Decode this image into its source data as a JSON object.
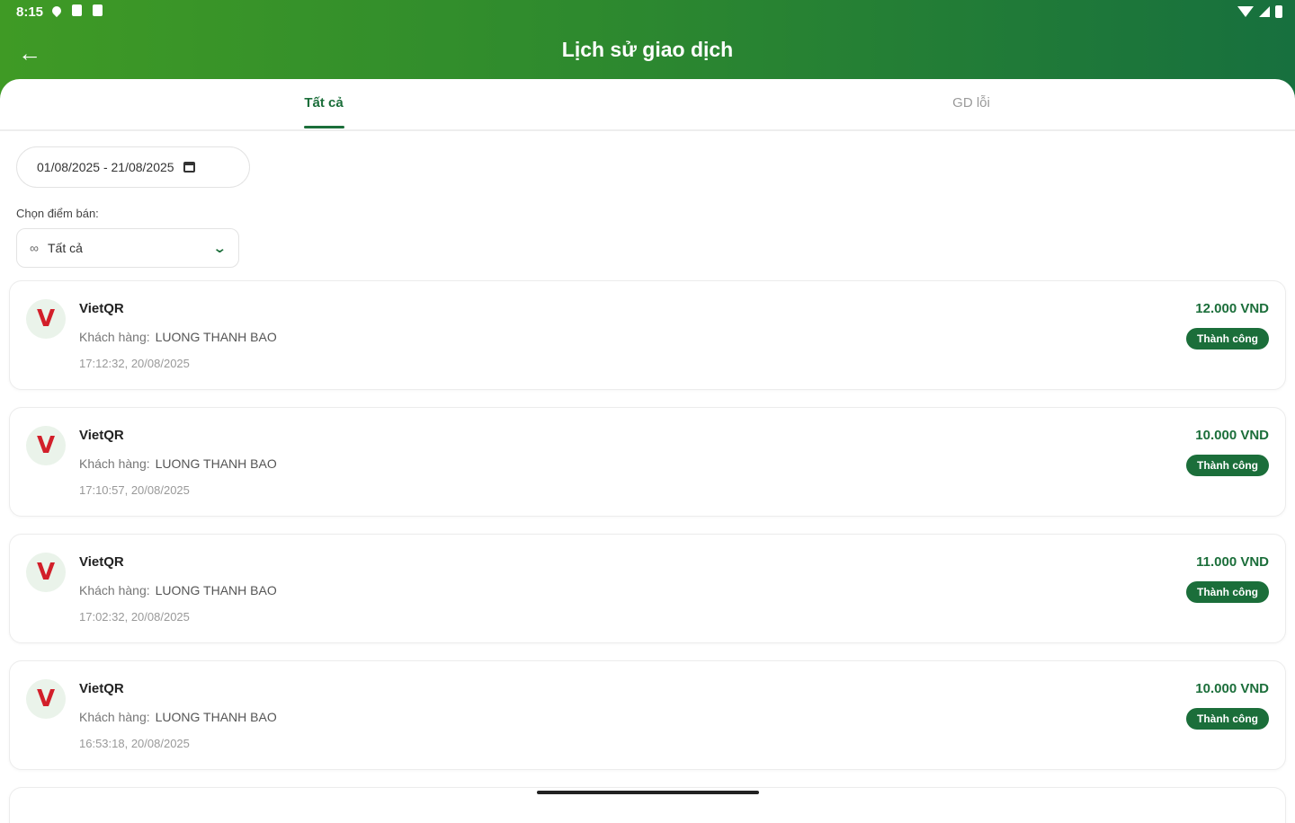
{
  "status_bar": {
    "time": "8:15"
  },
  "header": {
    "title": "Lịch sử giao dịch"
  },
  "tabs": [
    {
      "label": "Tất cả",
      "active": true
    },
    {
      "label": "GD lỗi",
      "active": false
    }
  ],
  "filter": {
    "date_range": "01/08/2025 - 21/08/2025",
    "select_label": "Chọn điểm bán:",
    "select_value": "Tất cả"
  },
  "transactions": [
    {
      "logo": "V",
      "name": "VietQR",
      "customer_label": "Khách hàng:",
      "customer": "LUONG THANH BAO",
      "time": "17:12:32, 20/08/2025",
      "amount": "12.000 VND",
      "status": "Thành công"
    },
    {
      "logo": "V",
      "name": "VietQR",
      "customer_label": "Khách hàng:",
      "customer": "LUONG THANH BAO",
      "time": "17:10:57, 20/08/2025",
      "amount": "10.000 VND",
      "status": "Thành công"
    },
    {
      "logo": "V",
      "name": "VietQR",
      "customer_label": "Khách hàng:",
      "customer": "LUONG THANH BAO",
      "time": "17:02:32, 20/08/2025",
      "amount": "11.000 VND",
      "status": "Thành công"
    },
    {
      "logo": "V",
      "name": "VietQR",
      "customer_label": "Khách hàng:",
      "customer": "LUONG THANH BAO",
      "time": "16:53:18, 20/08/2025",
      "amount": "10.000 VND",
      "status": "Thành công"
    }
  ],
  "colors": {
    "primary": "#1b6e3a",
    "header_start": "#3f9a25",
    "header_end": "#17703e",
    "logo_red": "#d21f2a"
  }
}
